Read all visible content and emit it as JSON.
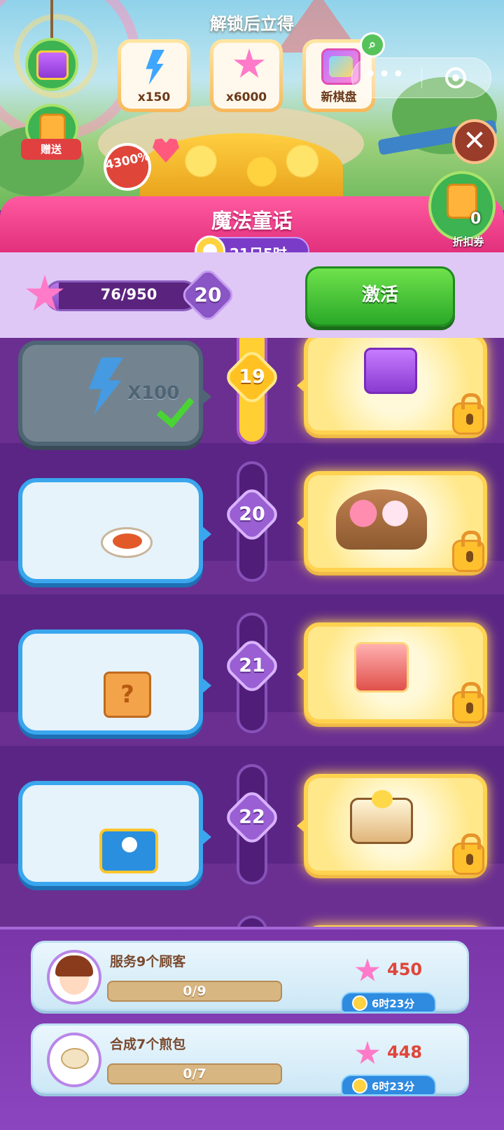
{
  "banner": {
    "unlock_title": "解锁后立得",
    "gift_label": "赠送",
    "bonus_percent": "4300%",
    "rewards": [
      {
        "icon": "lightning-icon",
        "label": "x150"
      },
      {
        "icon": "star-icon",
        "label": "x6000"
      },
      {
        "icon": "game-board-icon",
        "label": "新棋盘"
      }
    ]
  },
  "capsule": {
    "more": "•••"
  },
  "close": {
    "label": "✕"
  },
  "coupon": {
    "count": "0",
    "label": "折扣券"
  },
  "event": {
    "title": "魔法童话",
    "timer": "21日5时"
  },
  "progress": {
    "text": "76/950",
    "fraction": 0.08,
    "level": "20",
    "activate_label": "激活"
  },
  "levels": [
    {
      "level": "19",
      "free_reward": "lightning-icon",
      "free_text": "X100",
      "free_claimed": true,
      "vip_reward": "purple-chest-icon",
      "locked": true
    },
    {
      "level": "20",
      "free_reward": "oyster-icon",
      "free_claimed": false,
      "vip_reward": "food-platter-icon",
      "locked": true
    },
    {
      "level": "21",
      "free_reward": "mystery-box-icon",
      "free_claimed": false,
      "vip_reward": "mystery-chest-icon",
      "locked": true
    },
    {
      "level": "22",
      "free_reward": "blue-chest-icon",
      "free_claimed": false,
      "vip_reward": "cake-icon",
      "locked": true
    }
  ],
  "tasks": [
    {
      "name": "服务9个顾客",
      "progress_text": "0/9",
      "fraction": 0,
      "points": "450",
      "time": "6时23分"
    },
    {
      "name": "合成7个煎包",
      "progress_text": "0/7",
      "fraction": 0,
      "points": "448",
      "time": "6时23分"
    }
  ]
}
